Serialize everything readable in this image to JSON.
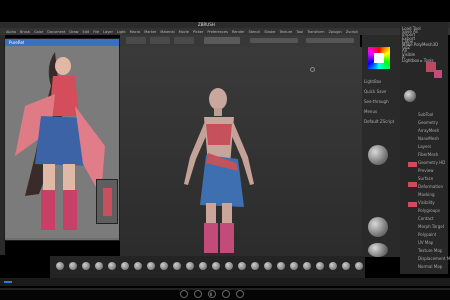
{
  "app": {
    "title": "ZBRUSH",
    "menu": [
      "Alpha",
      "Brush",
      "Color",
      "Document",
      "Draw",
      "Edit",
      "File",
      "Layer",
      "Light",
      "Macro",
      "Marker",
      "Material",
      "Movie",
      "Picker",
      "Preferences",
      "Render",
      "Stencil",
      "Stroke",
      "Texture",
      "Tool",
      "Transform",
      "Zplugin",
      "Zscript"
    ]
  },
  "reference_window": {
    "title": "PureRef"
  },
  "right_panel": {
    "labels": [
      "LightBox",
      "Quick Save",
      "See-through",
      "Menus",
      "Default ZScript"
    ]
  },
  "tool_panel": {
    "labels": [
      "Load Tool",
      "Save As",
      "Import",
      "Export",
      "Clone",
      "Make PolyMesh3D",
      "GoZ",
      "All",
      "Visible",
      "R",
      "Lightbox ▸ Tools"
    ]
  },
  "properties": {
    "labels": [
      "SubTool",
      "Geometry",
      "ArrayMesh",
      "NanoMesh",
      "Layers",
      "FiberMesh",
      "Geometry HD",
      "Preview",
      "Surface",
      "Deformation",
      "Masking",
      "Visibility",
      "Polygroups",
      "Contact",
      "Morph Target",
      "Polypaint",
      "UV Map",
      "Texture Map",
      "Displacement Map",
      "Normal Map"
    ]
  },
  "accent": "#2e79d6",
  "status": {
    "playback": "II"
  }
}
